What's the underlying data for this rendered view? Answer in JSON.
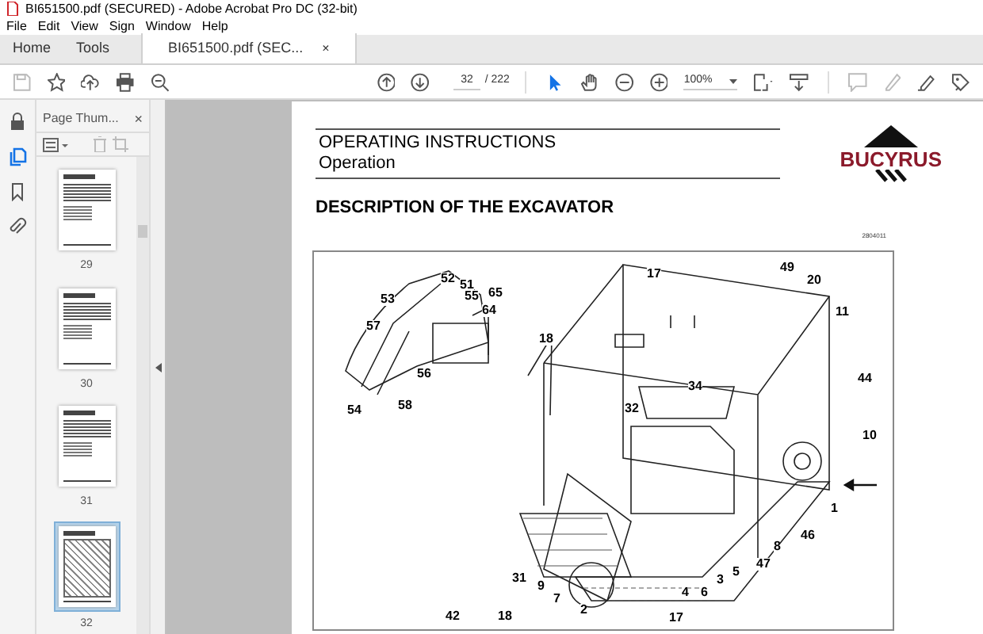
{
  "window": {
    "title": "BI651500.pdf (SECURED) - Adobe Acrobat Pro DC (32-bit)"
  },
  "menu": [
    "File",
    "Edit",
    "View",
    "Sign",
    "Window",
    "Help"
  ],
  "tabs": [
    {
      "label": "Home",
      "selected": false
    },
    {
      "label": "Tools",
      "selected": false
    },
    {
      "label": "BI651500.pdf (SEC...",
      "selected": true,
      "close": "×"
    }
  ],
  "toolbar": {
    "page_number": "32",
    "page_total": "/ 222",
    "zoom": "100%",
    "tools": [
      {
        "kind": "select",
        "selected": true
      },
      {
        "kind": "hand",
        "selected": false
      }
    ]
  },
  "sidebar": {
    "rail": [
      {
        "kind": "lock",
        "selected": false
      },
      {
        "kind": "pages",
        "selected": true
      },
      {
        "kind": "bookmark",
        "selected": false
      },
      {
        "kind": "attach",
        "selected": false
      }
    ],
    "panel_title": "Page Thum...",
    "close": "×",
    "thumbnails": [
      {
        "label": "29",
        "selected": false
      },
      {
        "label": "30",
        "selected": false
      },
      {
        "label": "31",
        "selected": false
      },
      {
        "label": "32",
        "selected": true
      }
    ]
  },
  "document": {
    "header_title": "OPERATING INSTRUCTIONS",
    "header_subtitle": "Operation",
    "logo": "BUCYRUS",
    "heading": "DESCRIPTION OF THE EXCAVATOR",
    "doc_code": "2804011",
    "callouts": [
      "52",
      "51",
      "65",
      "53",
      "55",
      "64",
      "57",
      "56",
      "54",
      "58",
      "17",
      "49",
      "20",
      "11",
      "18",
      "44",
      "34",
      "32",
      "10",
      "1",
      "46",
      "8",
      "47",
      "5",
      "3",
      "4",
      "6",
      "7",
      "9",
      "31",
      "2",
      "42",
      "18",
      "17"
    ]
  }
}
